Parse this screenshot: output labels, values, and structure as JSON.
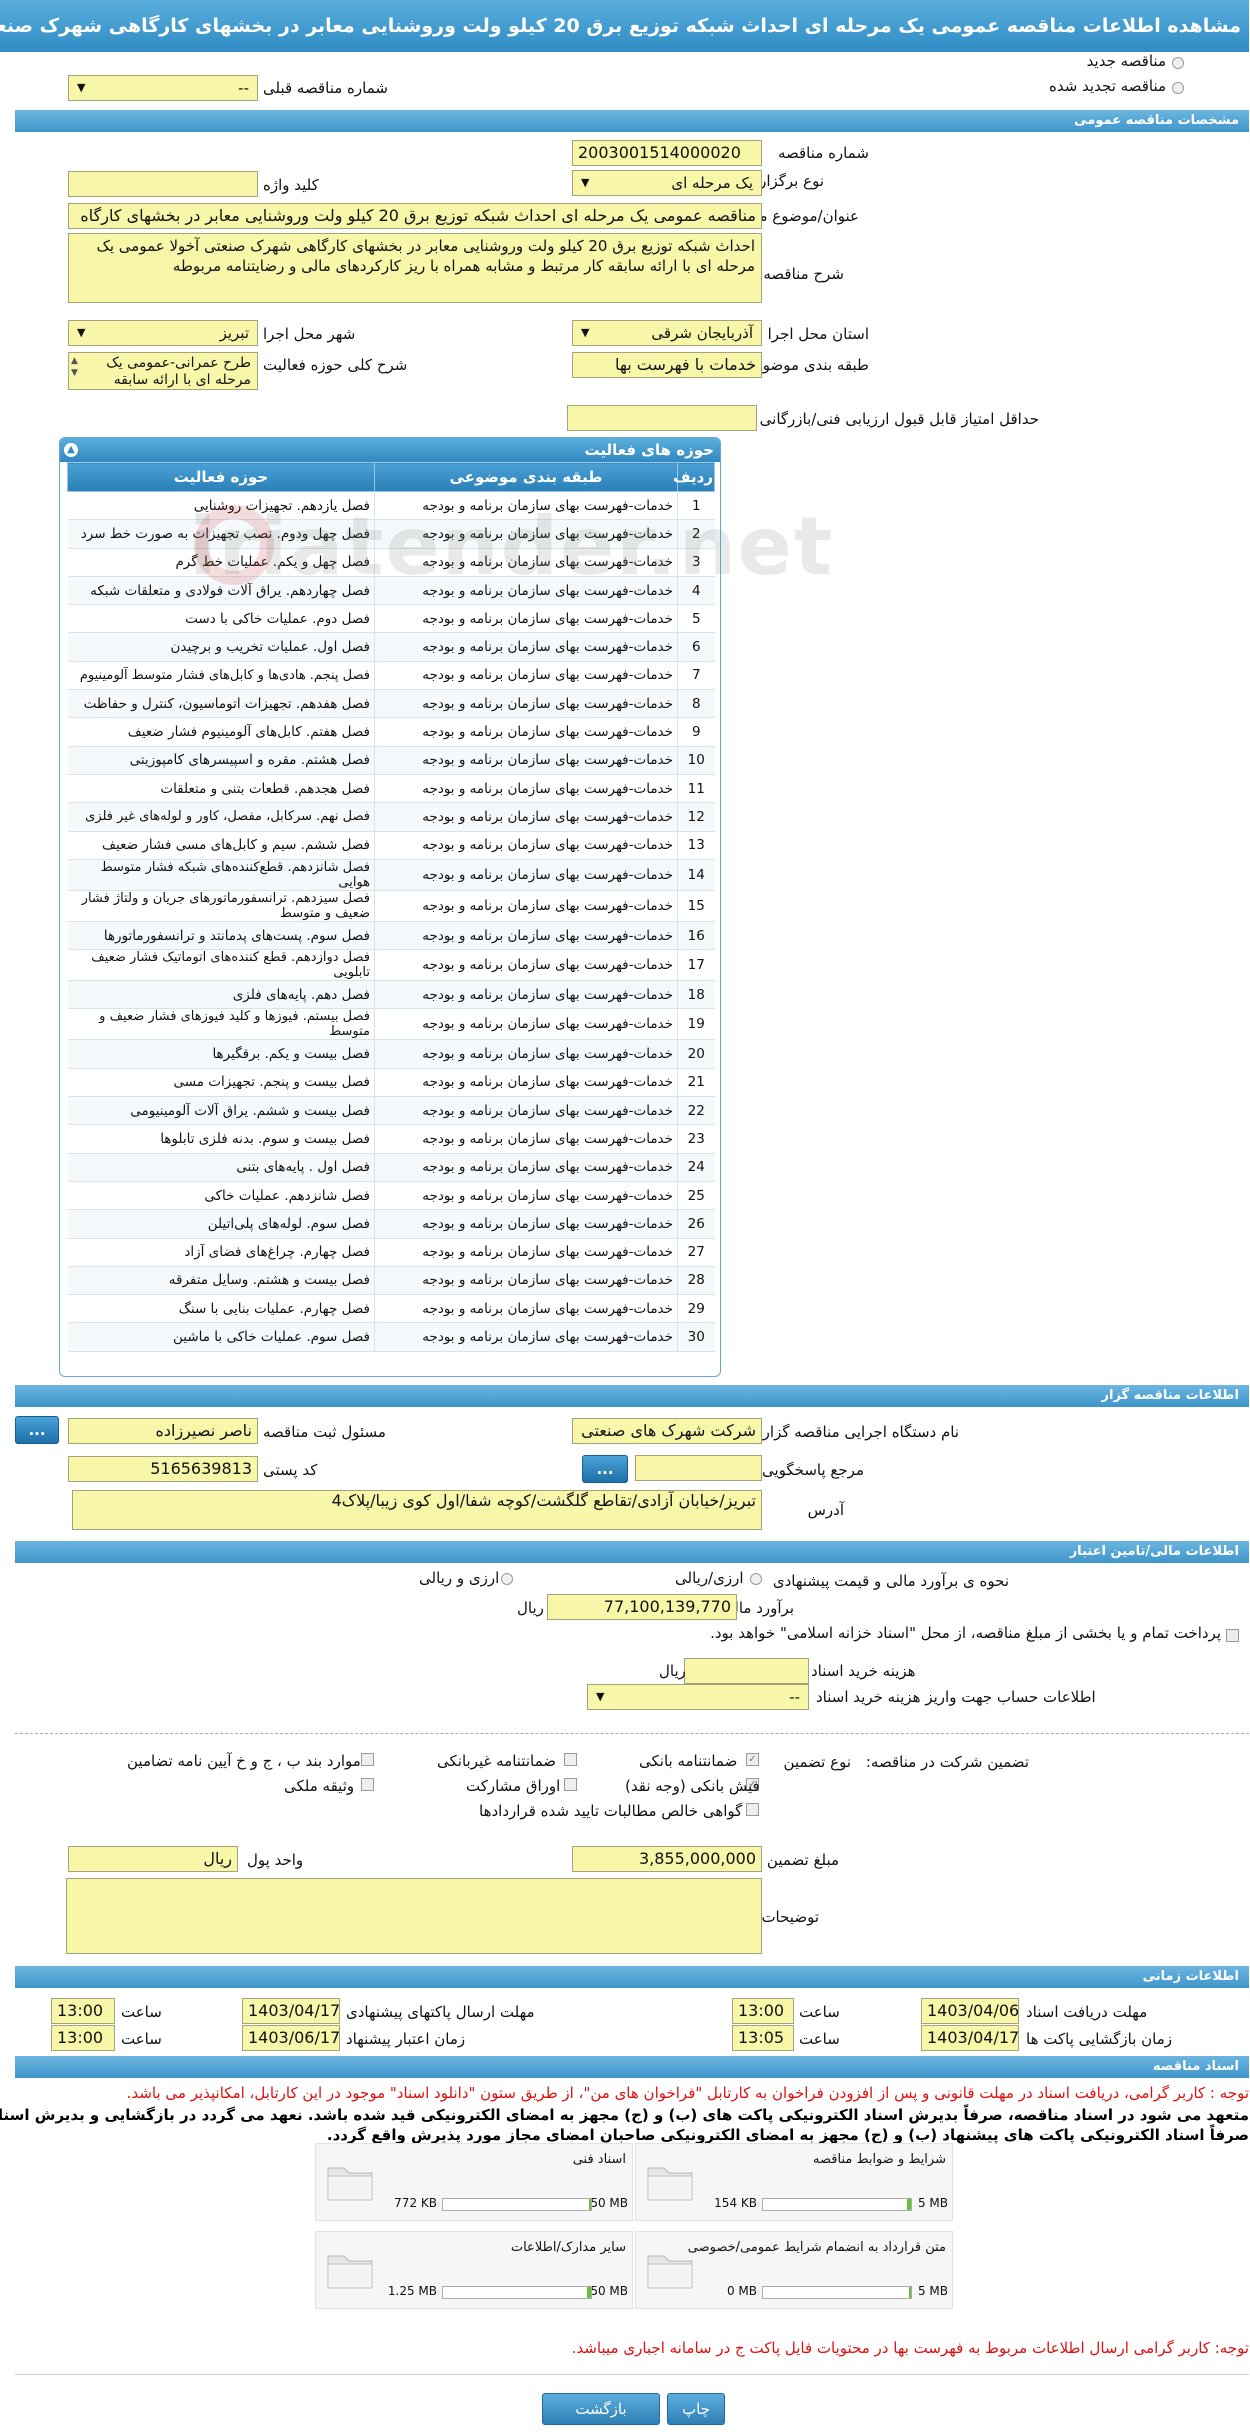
{
  "page_title": "مشاهده اطلاعات مناقصه عمومی یک مرحله ای احداث شبکه توزیع برق 20 کیلو ولت وروشنایی معابر در بخشهای کارگاهی شهرک صنعتی آخولا",
  "tender_type": {
    "new_label": "مناقصه جدید",
    "renewed_label": "مناقصه تجدید شده",
    "prev_number_label": "شماره مناقصه قبلی",
    "prev_number_value": "--"
  },
  "general": {
    "section_title": "مشخصات مناقصه عمومی",
    "number_label": "شماره مناقصه",
    "number_value": "2003001514000020",
    "holding_label": "نوع برگزاری",
    "holding_value": "یک مرحله ای",
    "keyword_label": "کلید واژه",
    "keyword_value": "",
    "subject_label": "عنوان/موضوع مناقصه",
    "subject_value": "مناقصه عمومی یک مرحله ای احداث شبکه توزیع برق 20 کیلو ولت وروشنایی معابر در بخشهای کارگاه",
    "desc_label": "شرح مناقصه",
    "desc_value": "احداث شبکه توزیع برق 20 کیلو ولت وروشنایی معابر در بخشهای کارگاهی شهرک صنعتی آخولا عمومی یک مرحله ای با  ارائه سابقه کار مرتبط و مشابه  همراه با ریز کارکردهای مالی و رضایتنامه مربوطه",
    "province_label": "استان محل اجرا",
    "province_value": "آذربایجان شرقی",
    "city_label": "شهر محل اجرا",
    "city_value": "تبریز",
    "category_label": "طبقه بندی موضوعی",
    "category_value": "خدمات با فهرست بها",
    "activity_desc_label": "شرح کلی حوزه فعالیت",
    "activity_desc_value": "طرح عمرانی-عمومی یک مرحله ای با  ارائه سابقه",
    "min_score_label": "حداقل امتیاز قابل قبول ارزیابی فنی/بازرگانی",
    "min_score_value": ""
  },
  "activities": {
    "panel_title": "حوزه های فعالیت",
    "col_row": "ردیف",
    "col_category": "طبقه بندی موضوعی",
    "col_field": "حوزه فعالیت",
    "rows": [
      {
        "n": "1",
        "cat": "خدمات-فهرست بهای سازمان برنامه و بودجه",
        "field": "فصل یازدهم. تجهیزات روشنایی"
      },
      {
        "n": "2",
        "cat": "خدمات-فهرست بهای سازمان برنامه و بودجه",
        "field": "فصل چهل ودوم. نصب تجهیزات به صورت خط سرد"
      },
      {
        "n": "3",
        "cat": "خدمات-فهرست بهای سازمان برنامه و بودجه",
        "field": "فصل چهل و یکم. عملیات خط گرم"
      },
      {
        "n": "4",
        "cat": "خدمات-فهرست بهای سازمان برنامه و بودجه",
        "field": "فصل چهاردهم. یراق آلات فولادی و متعلقات شبکه"
      },
      {
        "n": "5",
        "cat": "خدمات-فهرست بهای سازمان برنامه و بودجه",
        "field": "فصل دوم. عملیات خاکی با دست"
      },
      {
        "n": "6",
        "cat": "خدمات-فهرست بهای سازمان برنامه و بودجه",
        "field": "فصل اول. عملیات تخریب و برچیدن"
      },
      {
        "n": "7",
        "cat": "خدمات-فهرست بهای سازمان برنامه و بودجه",
        "field": "فصل پنجم. هادی‌ها و کابل‌های فشار متوسط آلومینیوم"
      },
      {
        "n": "8",
        "cat": "خدمات-فهرست بهای سازمان برنامه و بودجه",
        "field": "فصل هفدهم. تجهیزات اتوماسیون، کنترل و حفاظت"
      },
      {
        "n": "9",
        "cat": "خدمات-فهرست بهای سازمان برنامه و بودجه",
        "field": "فصل هفتم. کابل‌های آلومینیوم فشار ضعیف"
      },
      {
        "n": "10",
        "cat": "خدمات-فهرست بهای سازمان برنامه و بودجه",
        "field": "فصل هشتم. مقره و اسپیسرهای کامپوزیتی"
      },
      {
        "n": "11",
        "cat": "خدمات-فهرست بهای سازمان برنامه و بودجه",
        "field": "فصل هجدهم. قطعات بتنی و متعلقات"
      },
      {
        "n": "12",
        "cat": "خدمات-فهرست بهای سازمان برنامه و بودجه",
        "field": "فصل نهم. سرکابل، مفصل، کاور و لوله‌های غیر فلزی"
      },
      {
        "n": "13",
        "cat": "خدمات-فهرست بهای سازمان برنامه و بودجه",
        "field": "فصل ششم. سیم و کابل‌های مسی فشار ضعیف"
      },
      {
        "n": "14",
        "cat": "خدمات-فهرست بهای سازمان برنامه و بودجه",
        "field": "فصل شانزدهم. قطع‌کننده‌های شبکه فشار متوسط هوایی"
      },
      {
        "n": "15",
        "cat": "خدمات-فهرست بهای سازمان برنامه و بودجه",
        "field": "فصل سیزدهم. ترانسفورماتورهای جریان و ولتاژ فشار ضعیف و متوسط"
      },
      {
        "n": "16",
        "cat": "خدمات-فهرست بهای سازمان برنامه و بودجه",
        "field": "فصل سوم. پست‌های پدمانتد و ترانسفورماتورها"
      },
      {
        "n": "17",
        "cat": "خدمات-فهرست بهای سازمان برنامه و بودجه",
        "field": "فصل دوازدهم. قطع کننده‌های اتوماتیک فشار ضعیف تابلویی"
      },
      {
        "n": "18",
        "cat": "خدمات-فهرست بهای سازمان برنامه و بودجه",
        "field": "فصل دهم. پایه‌های فلزی"
      },
      {
        "n": "19",
        "cat": "خدمات-فهرست بهای سازمان برنامه و بودجه",
        "field": "فصل بیستم. فیوزها و کلید فیوزهای فشار ضعیف و متوسط"
      },
      {
        "n": "20",
        "cat": "خدمات-فهرست بهای سازمان برنامه و بودجه",
        "field": "فصل بیست و یکم. برقگیرها"
      },
      {
        "n": "21",
        "cat": "خدمات-فهرست بهای سازمان برنامه و بودجه",
        "field": "فصل بیست و پنجم. تجهیزات مسی"
      },
      {
        "n": "22",
        "cat": "خدمات-فهرست بهای سازمان برنامه و بودجه",
        "field": "فصل بیست و ششم. یراق آلات آلومینیومی"
      },
      {
        "n": "23",
        "cat": "خدمات-فهرست بهای سازمان برنامه و بودجه",
        "field": "فصل بیست و سوم. بدنه فلزی تابلوها"
      },
      {
        "n": "24",
        "cat": "خدمات-فهرست بهای سازمان برنامه و بودجه",
        "field": "فصل اول . پایه‌های بتنی"
      },
      {
        "n": "25",
        "cat": "خدمات-فهرست بهای سازمان برنامه و بودجه",
        "field": "فصل شانزدهم. عملیات خاکی"
      },
      {
        "n": "26",
        "cat": "خدمات-فهرست بهای سازمان برنامه و بودجه",
        "field": "فصل سوم. لوله‌های پلی‌اتیلن"
      },
      {
        "n": "27",
        "cat": "خدمات-فهرست بهای سازمان برنامه و بودجه",
        "field": "فصل چهارم. چراغ‌های فضای آزاد"
      },
      {
        "n": "28",
        "cat": "خدمات-فهرست بهای سازمان برنامه و بودجه",
        "field": "فصل بیست و هشتم. وسایل متفرقه"
      },
      {
        "n": "29",
        "cat": "خدمات-فهرست بهای سازمان برنامه و بودجه",
        "field": "فصل چهارم. عملیات بنایی با سنگ"
      },
      {
        "n": "30",
        "cat": "خدمات-فهرست بهای سازمان برنامه و بودجه",
        "field": "فصل سوم. عملیات خاکی با ماشین"
      }
    ]
  },
  "organizer": {
    "section_title": "اطلاعات مناقصه گزار",
    "org_label": "نام دستگاه اجرایی مناقصه گزار",
    "org_value": "شرکت شهرک های صنعتی",
    "official_label": "مسئول ثبت مناقصه",
    "official_value": "ناصر نصیرزاده",
    "ref_label": "مرجع پاسخگویی",
    "ref_value": "",
    "postal_label": "کد پستی",
    "postal_value": "5165639813",
    "address_label": "آدرس",
    "address_value": "تبریز/خیابان آزادی/تقاطع گلگشت/کوچه شفا/اول کوی زیبا/پلاک4",
    "dots": "..."
  },
  "finance": {
    "section_title": "اطلاعات مالی/تامین اعتبار",
    "method_label": "نحوه ی برآورد مالی و قیمت پیشنهادی",
    "opt1": "ارزی/ریالی",
    "opt2": "ارزی و ریالی",
    "estimate_label": "برآورد مالی",
    "estimate_value": "77,100,139,770",
    "currency": "ریال",
    "treasury_text": "پرداخت تمام و یا بخشی از مبلغ مناقصه، از محل \"اسناد خزانه اسلامی\" خواهد بود.",
    "doc_cost_label": "هزینه خرید اسناد",
    "doc_cost_value": "",
    "doc_cost_unit": "ریال",
    "account_label": "اطلاعات حساب جهت واریز هزینه خرید اسناد",
    "account_value": "--"
  },
  "guarantee": {
    "label": "تضمین شرکت در مناقصه:",
    "type_label": "نوع تضمین",
    "bank": "ضمانتنامه بانکی",
    "nonbank": "ضمانتنامه غیربانکی",
    "article": "موارد بند ب ، ج و خ آیین نامه تضامین",
    "cash": "فیش بانکی (وجه نقد)",
    "bonds": "اوراق مشارکت",
    "property": "وثیقه ملکی",
    "claims": "گواهی خالص مطالبات تایید شده قراردادها",
    "amount_label": "مبلغ تضمین",
    "amount_value": "3,855,000,000",
    "unit_label": "واحد پول",
    "unit_value": "ریال",
    "notes_label": "توضیحات",
    "notes_value": ""
  },
  "timing": {
    "section_title": "اطلاعات زمانی",
    "doc_deadline_label": "مهلت دریافت اسناد",
    "doc_deadline_date": "1403/04/06",
    "doc_deadline_time": "13:00",
    "submit_deadline_label": "مهلت ارسال پاکتهای پیشنهادی",
    "submit_deadline_date": "1403/04/17",
    "submit_deadline_time": "13:00",
    "opening_label": "زمان بازگشایی پاکت ها",
    "opening_date": "1403/04/17",
    "opening_time": "13:05",
    "validity_label": "زمان اعتبار پیشنهاد",
    "validity_date": "1403/06/17",
    "validity_time": "13:00",
    "time_label": "ساعت"
  },
  "documents": {
    "section_title": "اسناد مناقصه",
    "note1": "توجه : کاربر گرامی، دریافت اسناد در مهلت قانونی و پس از افزودن فراخوان به کارتابل \"فراخوان های من\"، از طریق ستون \"دانلود اسناد\" موجود در این کارتابل، امکانپذیر می باشد.",
    "note2": "متعهد می شود در اسناد مناقصه، صرفاً بدیرش اسناد الکترونیکی پاکت های (ب) و (ج) مجهز به امضای الکترونیکی قید شده باشد. نعهد می گردد در بازگشایی و بدیرش اسناد،",
    "note3": "صرفاً اسناد الکترونیکی پاکت های پیشنهاد (ب) و (ج) مجهز به امضای الکترونیکی صاحبان امضای مجاز مورد پذیرش واقع گردد.",
    "files": [
      {
        "name": "شرایط و ضوابط مناقصه",
        "size": "154 KB",
        "max": "5 MB",
        "fill": 0.03
      },
      {
        "name": "اسناد فنی",
        "size": "772 KB",
        "max": "50 MB",
        "fill": 0.015
      },
      {
        "name": "متن قرارداد به انضمام شرایط عمومی/خصوصی",
        "size": "0 MB",
        "max": "5 MB",
        "fill": 0.0
      },
      {
        "name": "سایر مدارک/اطلاعات",
        "size": "1.25 MB",
        "max": "50 MB",
        "fill": 0.025
      }
    ],
    "note4": "توجه: کاربر گرامی ارسال اطلاعات مربوط به فهرست بها در محتویات فایل پاکت ج در سامانه اجباری میباشد."
  },
  "actions": {
    "return_label": "بازگشت",
    "print_label": "چاپ"
  },
  "watermark": "iriatender.net"
}
